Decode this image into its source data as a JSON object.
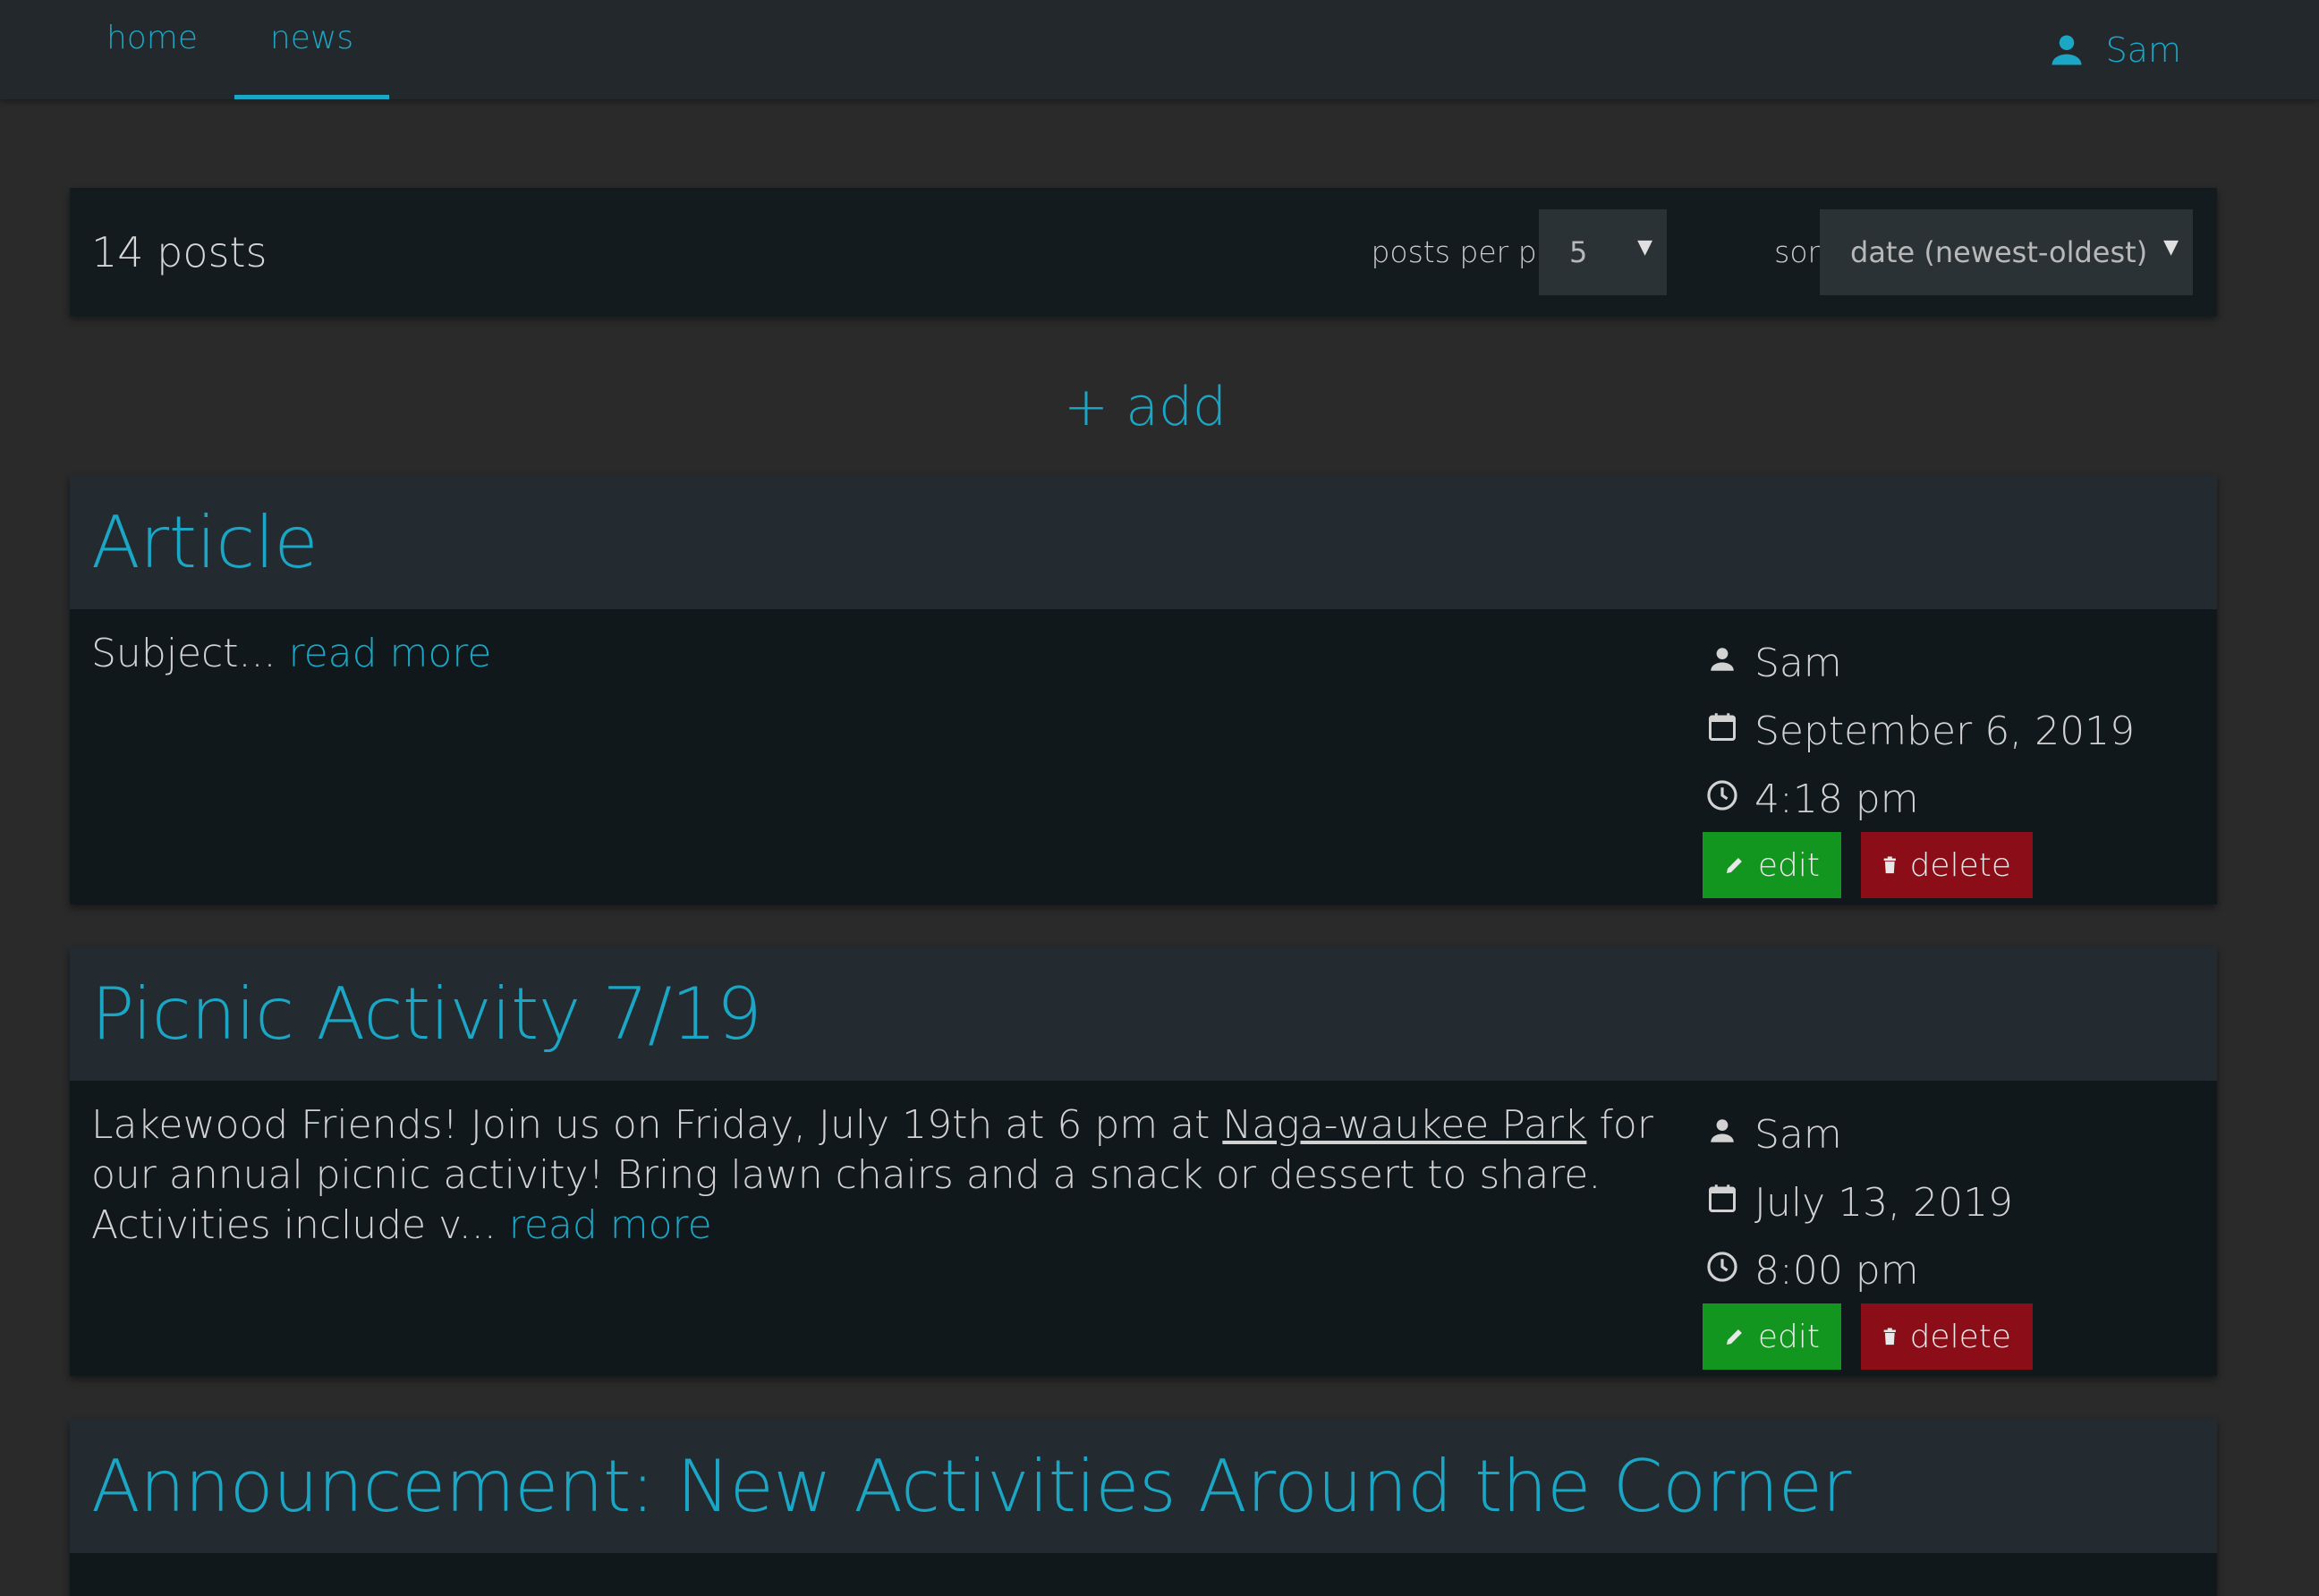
{
  "nav": {
    "home_label": "home",
    "news_label": "news",
    "user_name": "Sam",
    "user_icon": "person-icon",
    "accent_color": "#1aa6c4"
  },
  "toolbar": {
    "post_count": "14 posts",
    "posts_per_page_label": "posts per page",
    "posts_per_page_value": "5",
    "sort_by_label": "sort by",
    "sort_by_value": "date (newest-oldest)"
  },
  "add_label": "+ add",
  "posts": [
    {
      "title": "Article",
      "text": "Subject...",
      "read_more": "read more",
      "author": "Sam",
      "date": "September 6, 2019",
      "time": "4:18 pm",
      "edit_label": "edit",
      "delete_label": "delete"
    },
    {
      "title": "Picnic Activity 7/19",
      "text_before": "Lakewood Friends! Join us on Friday, July 19th at 6 pm at ",
      "link_text": "Naga-waukee Park",
      "text_after": " for our annual picnic activity! Bring lawn chairs and a snack or dessert to share. Activities include v...",
      "read_more": "read more",
      "author": "Sam",
      "date": "July 13, 2019",
      "time": "8:00 pm",
      "edit_label": "edit",
      "delete_label": "delete"
    },
    {
      "title": "Announcement: New Activities Around the Corner"
    }
  ],
  "colors": {
    "edit_button": "#13961f",
    "delete_button": "#8a0d17",
    "card_header": "#232b30",
    "card_body": "#11181b"
  }
}
